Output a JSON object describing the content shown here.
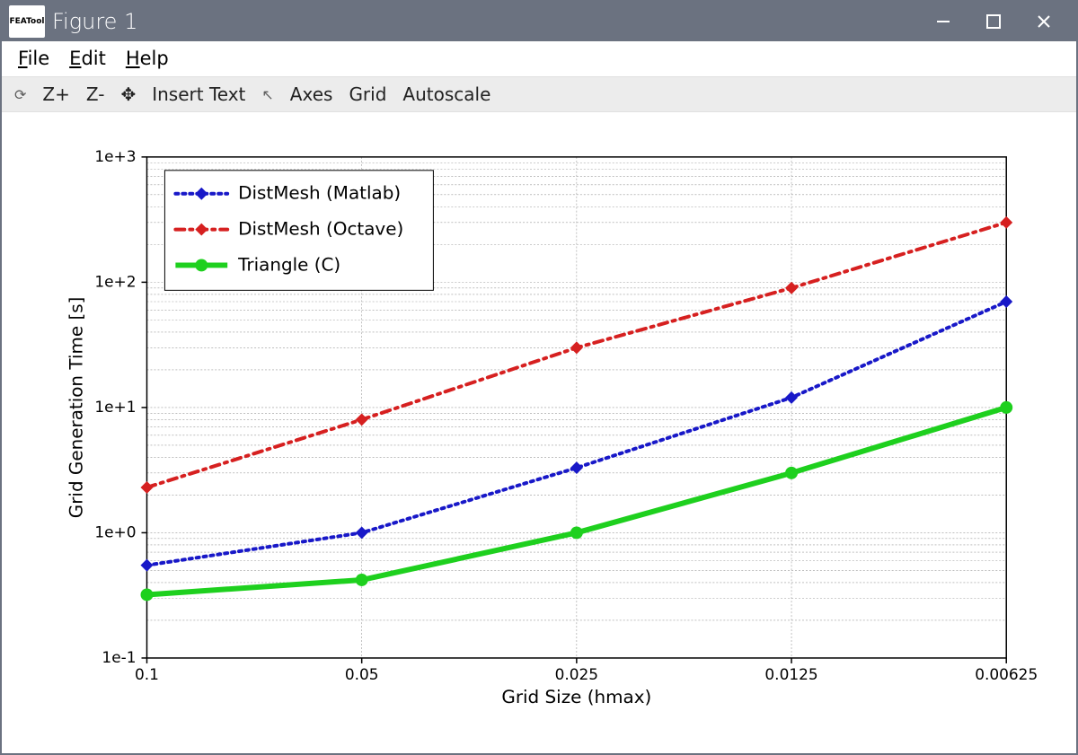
{
  "window": {
    "title": "Figure 1",
    "logo_text": "FEATool"
  },
  "menubar": {
    "file": "File",
    "edit": "Edit",
    "help": "Help"
  },
  "toolbar": {
    "reset": "⟳",
    "zplus": "Z+",
    "zminus": "Z-",
    "pan": "✥",
    "insert_text": "Insert Text",
    "pointer": "↖",
    "axes": "Axes",
    "grid": "Grid",
    "autoscale": "Autoscale"
  },
  "chart_data": {
    "type": "line",
    "xlabel": "Grid Size (hmax)",
    "ylabel": "Grid Generation Time [s]",
    "x_ticks": [
      "0.1",
      "0.05",
      "0.025",
      "0.0125",
      "0.00625"
    ],
    "y_ticks": [
      "1e-1",
      "1e+0",
      "1e+1",
      "1e+2",
      "1e+3"
    ],
    "x": [
      0.1,
      0.05,
      0.025,
      0.0125,
      0.00625
    ],
    "x_log2_idx": [
      0,
      1,
      2,
      3,
      4
    ],
    "ylim_log10": [
      -1,
      3
    ],
    "series": [
      {
        "name": "DistMesh (Matlab)",
        "color": "blue",
        "style": "dotted",
        "y": [
          0.55,
          1.0,
          3.3,
          12,
          70
        ]
      },
      {
        "name": "DistMesh (Octave)",
        "color": "red",
        "style": "dashdot",
        "y": [
          2.3,
          8.0,
          30,
          90,
          300
        ]
      },
      {
        "name": "Triangle (C)",
        "color": "green",
        "style": "solid",
        "y": [
          0.32,
          0.42,
          1.0,
          3.0,
          10
        ]
      }
    ],
    "legend_position": "top-left"
  }
}
